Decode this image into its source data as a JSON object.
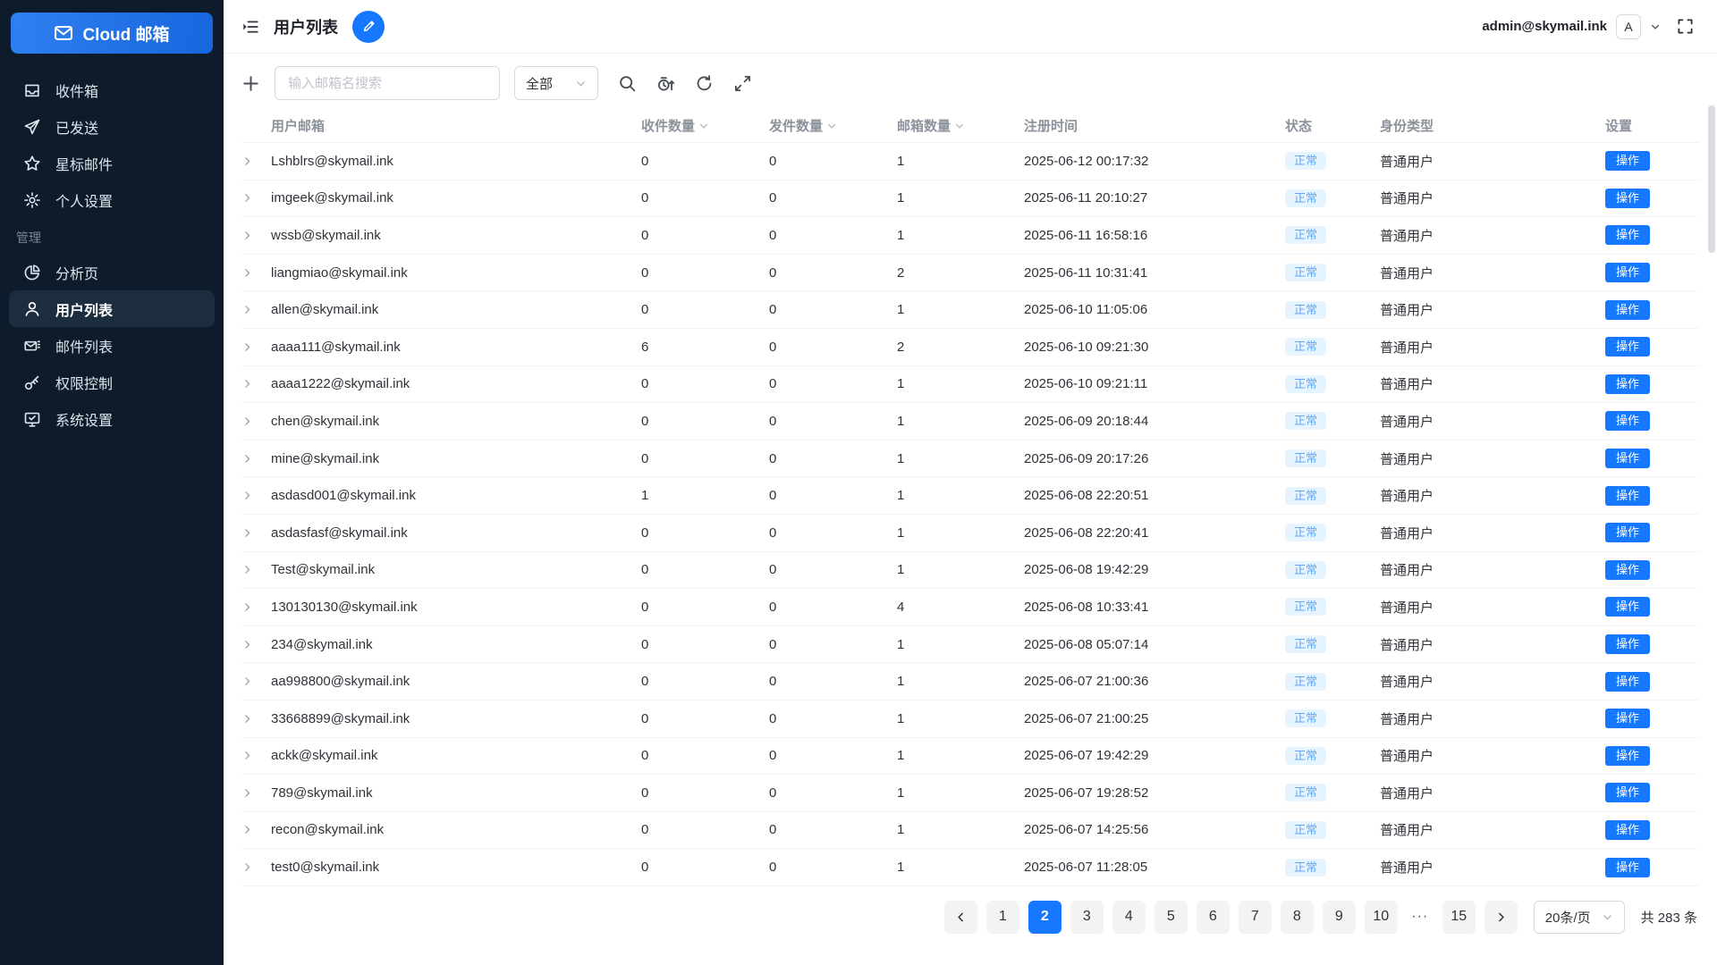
{
  "colors": {
    "accent": "#1677ff",
    "sidebar_bg": "#0d1b2b",
    "badge_bg": "#e6f4ff",
    "badge_text": "#62a8f7"
  },
  "sidebar": {
    "logo": {
      "label": "Cloud 邮箱",
      "icon": "envelope-icon"
    },
    "items": [
      {
        "icon": "inbox-icon",
        "label": "收件箱"
      },
      {
        "icon": "send-icon",
        "label": "已发送"
      },
      {
        "icon": "star-icon",
        "label": "星标邮件"
      },
      {
        "icon": "gear-icon",
        "label": "个人设置"
      },
      {
        "section": "管理"
      },
      {
        "icon": "pie-chart-icon",
        "label": "分析页"
      },
      {
        "icon": "user-icon",
        "label": "用户列表",
        "active": true
      },
      {
        "icon": "mail-list-icon",
        "label": "邮件列表"
      },
      {
        "icon": "key-icon",
        "label": "权限控制"
      },
      {
        "icon": "monitor-icon",
        "label": "系统设置"
      }
    ]
  },
  "topbar": {
    "title": "用户列表",
    "account_email": "admin@skymail.ink",
    "avatar_letter": "A"
  },
  "toolbar": {
    "search_placeholder": "输入邮箱名搜索",
    "filter_value": "全部"
  },
  "table": {
    "columns": [
      {
        "label": "用户邮箱"
      },
      {
        "label": "收件数量",
        "sortable": true
      },
      {
        "label": "发件数量",
        "sortable": true
      },
      {
        "label": "邮箱数量",
        "sortable": true
      },
      {
        "label": "注册时间"
      },
      {
        "label": "状态"
      },
      {
        "label": "身份类型"
      },
      {
        "label": "设置"
      }
    ],
    "rows": [
      {
        "email": "Lshblrs@skymail.ink",
        "inbox": "0",
        "sent": "0",
        "mailboxes": "1",
        "registered": "2025-06-12 00:17:32",
        "status": "正常",
        "identity": "普通用户",
        "action": "操作"
      },
      {
        "email": "imgeek@skymail.ink",
        "inbox": "0",
        "sent": "0",
        "mailboxes": "1",
        "registered": "2025-06-11 20:10:27",
        "status": "正常",
        "identity": "普通用户",
        "action": "操作"
      },
      {
        "email": "wssb@skymail.ink",
        "inbox": "0",
        "sent": "0",
        "mailboxes": "1",
        "registered": "2025-06-11 16:58:16",
        "status": "正常",
        "identity": "普通用户",
        "action": "操作"
      },
      {
        "email": "liangmiao@skymail.ink",
        "inbox": "0",
        "sent": "0",
        "mailboxes": "2",
        "registered": "2025-06-11 10:31:41",
        "status": "正常",
        "identity": "普通用户",
        "action": "操作"
      },
      {
        "email": "allen@skymail.ink",
        "inbox": "0",
        "sent": "0",
        "mailboxes": "1",
        "registered": "2025-06-10 11:05:06",
        "status": "正常",
        "identity": "普通用户",
        "action": "操作"
      },
      {
        "email": "aaaa111@skymail.ink",
        "inbox": "6",
        "sent": "0",
        "mailboxes": "2",
        "registered": "2025-06-10 09:21:30",
        "status": "正常",
        "identity": "普通用户",
        "action": "操作"
      },
      {
        "email": "aaaa1222@skymail.ink",
        "inbox": "0",
        "sent": "0",
        "mailboxes": "1",
        "registered": "2025-06-10 09:21:11",
        "status": "正常",
        "identity": "普通用户",
        "action": "操作"
      },
      {
        "email": "chen@skymail.ink",
        "inbox": "0",
        "sent": "0",
        "mailboxes": "1",
        "registered": "2025-06-09 20:18:44",
        "status": "正常",
        "identity": "普通用户",
        "action": "操作"
      },
      {
        "email": "mine@skymail.ink",
        "inbox": "0",
        "sent": "0",
        "mailboxes": "1",
        "registered": "2025-06-09 20:17:26",
        "status": "正常",
        "identity": "普通用户",
        "action": "操作"
      },
      {
        "email": "asdasd001@skymail.ink",
        "inbox": "1",
        "sent": "0",
        "mailboxes": "1",
        "registered": "2025-06-08 22:20:51",
        "status": "正常",
        "identity": "普通用户",
        "action": "操作"
      },
      {
        "email": "asdasfasf@skymail.ink",
        "inbox": "0",
        "sent": "0",
        "mailboxes": "1",
        "registered": "2025-06-08 22:20:41",
        "status": "正常",
        "identity": "普通用户",
        "action": "操作"
      },
      {
        "email": "Test@skymail.ink",
        "inbox": "0",
        "sent": "0",
        "mailboxes": "1",
        "registered": "2025-06-08 19:42:29",
        "status": "正常",
        "identity": "普通用户",
        "action": "操作"
      },
      {
        "email": "130130130@skymail.ink",
        "inbox": "0",
        "sent": "0",
        "mailboxes": "4",
        "registered": "2025-06-08 10:33:41",
        "status": "正常",
        "identity": "普通用户",
        "action": "操作"
      },
      {
        "email": "234@skymail.ink",
        "inbox": "0",
        "sent": "0",
        "mailboxes": "1",
        "registered": "2025-06-08 05:07:14",
        "status": "正常",
        "identity": "普通用户",
        "action": "操作"
      },
      {
        "email": "aa998800@skymail.ink",
        "inbox": "0",
        "sent": "0",
        "mailboxes": "1",
        "registered": "2025-06-07 21:00:36",
        "status": "正常",
        "identity": "普通用户",
        "action": "操作"
      },
      {
        "email": "33668899@skymail.ink",
        "inbox": "0",
        "sent": "0",
        "mailboxes": "1",
        "registered": "2025-06-07 21:00:25",
        "status": "正常",
        "identity": "普通用户",
        "action": "操作"
      },
      {
        "email": "ackk@skymail.ink",
        "inbox": "0",
        "sent": "0",
        "mailboxes": "1",
        "registered": "2025-06-07 19:42:29",
        "status": "正常",
        "identity": "普通用户",
        "action": "操作"
      },
      {
        "email": "789@skymail.ink",
        "inbox": "0",
        "sent": "0",
        "mailboxes": "1",
        "registered": "2025-06-07 19:28:52",
        "status": "正常",
        "identity": "普通用户",
        "action": "操作"
      },
      {
        "email": "recon@skymail.ink",
        "inbox": "0",
        "sent": "0",
        "mailboxes": "1",
        "registered": "2025-06-07 14:25:56",
        "status": "正常",
        "identity": "普通用户",
        "action": "操作"
      },
      {
        "email": "test0@skymail.ink",
        "inbox": "0",
        "sent": "0",
        "mailboxes": "1",
        "registered": "2025-06-07 11:28:05",
        "status": "正常",
        "identity": "普通用户",
        "action": "操作"
      }
    ]
  },
  "pagination": {
    "pages": [
      "1",
      "2",
      "3",
      "4",
      "5",
      "6",
      "7",
      "8",
      "9",
      "10",
      "···",
      "15"
    ],
    "active": "2",
    "page_size": "20条/页",
    "total": "共 283 条"
  }
}
